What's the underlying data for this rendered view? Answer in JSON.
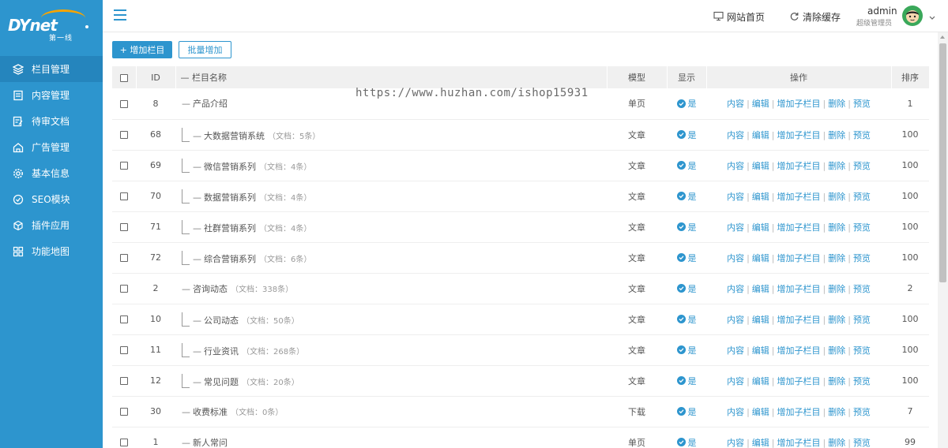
{
  "logo": {
    "main": "DYnet",
    "sub": "第一线"
  },
  "sidebar": {
    "items": [
      {
        "label": "栏目管理",
        "icon": "layers-icon",
        "active": true
      },
      {
        "label": "内容管理",
        "icon": "document-icon"
      },
      {
        "label": "待审文档",
        "icon": "edit-doc-icon"
      },
      {
        "label": "广告管理",
        "icon": "ad-house-icon"
      },
      {
        "label": "基本信息",
        "icon": "gear-icon"
      },
      {
        "label": "SEO模块",
        "icon": "seo-icon"
      },
      {
        "label": "插件应用",
        "icon": "cube-icon"
      },
      {
        "label": "功能地图",
        "icon": "grid-icon"
      }
    ]
  },
  "header": {
    "site_home": "网站首页",
    "clear_cache": "清除缓存",
    "user_name": "admin",
    "user_role": "超级管理员"
  },
  "toolbar": {
    "add_label": "+ 增加栏目",
    "batch_label": "批量增加"
  },
  "watermark": "https://www.huzhan.com/ishop15931",
  "table": {
    "headers": {
      "id": "ID",
      "name": "— 栏目名称",
      "model": "模型",
      "show": "显示",
      "ops": "操作",
      "sort": "排序"
    },
    "ops_labels": [
      "内容",
      "编辑",
      "增加子栏目",
      "删除",
      "预览"
    ],
    "show_label": "是",
    "rows": [
      {
        "id": "8",
        "name": "产品介绍",
        "docs": "",
        "child": false,
        "model": "单页",
        "sort": "1"
      },
      {
        "id": "68",
        "name": "大数据营销系统",
        "docs": "（文档：5条）",
        "child": true,
        "model": "文章",
        "sort": "100"
      },
      {
        "id": "69",
        "name": "微信营销系列",
        "docs": "（文档：4条）",
        "child": true,
        "model": "文章",
        "sort": "100"
      },
      {
        "id": "70",
        "name": "数据营销系列",
        "docs": "（文档：4条）",
        "child": true,
        "model": "文章",
        "sort": "100"
      },
      {
        "id": "71",
        "name": "社群营销系列",
        "docs": "（文档：4条）",
        "child": true,
        "model": "文章",
        "sort": "100"
      },
      {
        "id": "72",
        "name": "综合营销系列",
        "docs": "（文档：6条）",
        "child": true,
        "model": "文章",
        "sort": "100"
      },
      {
        "id": "2",
        "name": "咨询动态",
        "docs": "（文档：338条）",
        "child": false,
        "model": "文章",
        "sort": "2"
      },
      {
        "id": "10",
        "name": "公司动态",
        "docs": "（文档：50条）",
        "child": true,
        "model": "文章",
        "sort": "100"
      },
      {
        "id": "11",
        "name": "行业资讯",
        "docs": "（文档：268条）",
        "child": true,
        "model": "文章",
        "sort": "100"
      },
      {
        "id": "12",
        "name": "常见问题",
        "docs": "（文档：20条）",
        "child": true,
        "model": "文章",
        "sort": "100"
      },
      {
        "id": "30",
        "name": "收费标准",
        "docs": "（文档：0条）",
        "child": false,
        "model": "下载",
        "sort": "7"
      },
      {
        "id": "1",
        "name": "新人常问",
        "docs": "",
        "child": false,
        "model": "单页",
        "sort": "99"
      }
    ]
  }
}
